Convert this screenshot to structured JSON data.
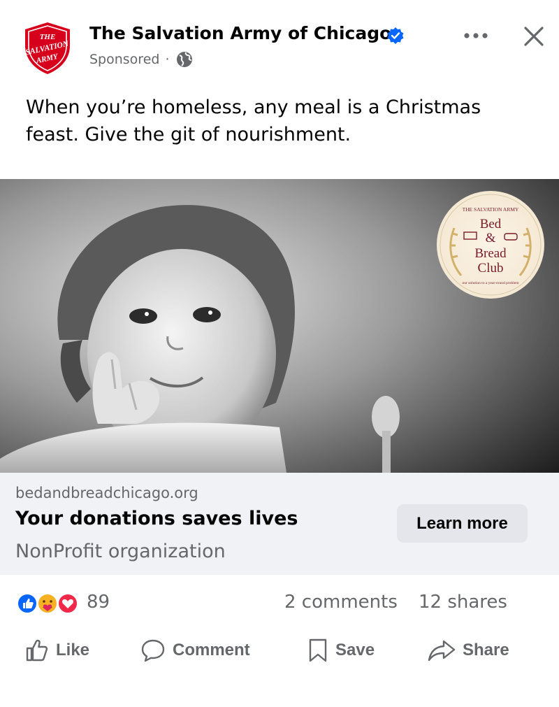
{
  "header": {
    "logo_text": "THE SALVATION ARMY",
    "page_name": "The Salvation Army of Chicago",
    "sponsored": "Sponsored",
    "separator": "·"
  },
  "post": {
    "text": "When you’re homeless, any meal is a Christmas feast. Give the git of nourishment."
  },
  "media": {
    "badge_top_text": "THE SALVATION ARMY",
    "badge_line1": "Bed",
    "badge_line2": "&",
    "badge_line3": "Bread",
    "badge_line4": "Club",
    "badge_bottom_text": "our solution to a year-round problem"
  },
  "link_card": {
    "domain": "bedandbreadchicago.org",
    "headline": "Your donations saves lives",
    "description": "NonProfit organization",
    "cta_label": "Learn more"
  },
  "stats": {
    "reaction_count": "89",
    "comments": "2 comments",
    "shares": "12 shares"
  },
  "actions": {
    "like": "Like",
    "comment": "Comment",
    "save": "Save",
    "share": "Share"
  },
  "colors": {
    "brand_red": "#d6001c",
    "verified_blue": "#0866ff",
    "card_bg": "#f0f2f5",
    "muted_text": "#65676b"
  }
}
